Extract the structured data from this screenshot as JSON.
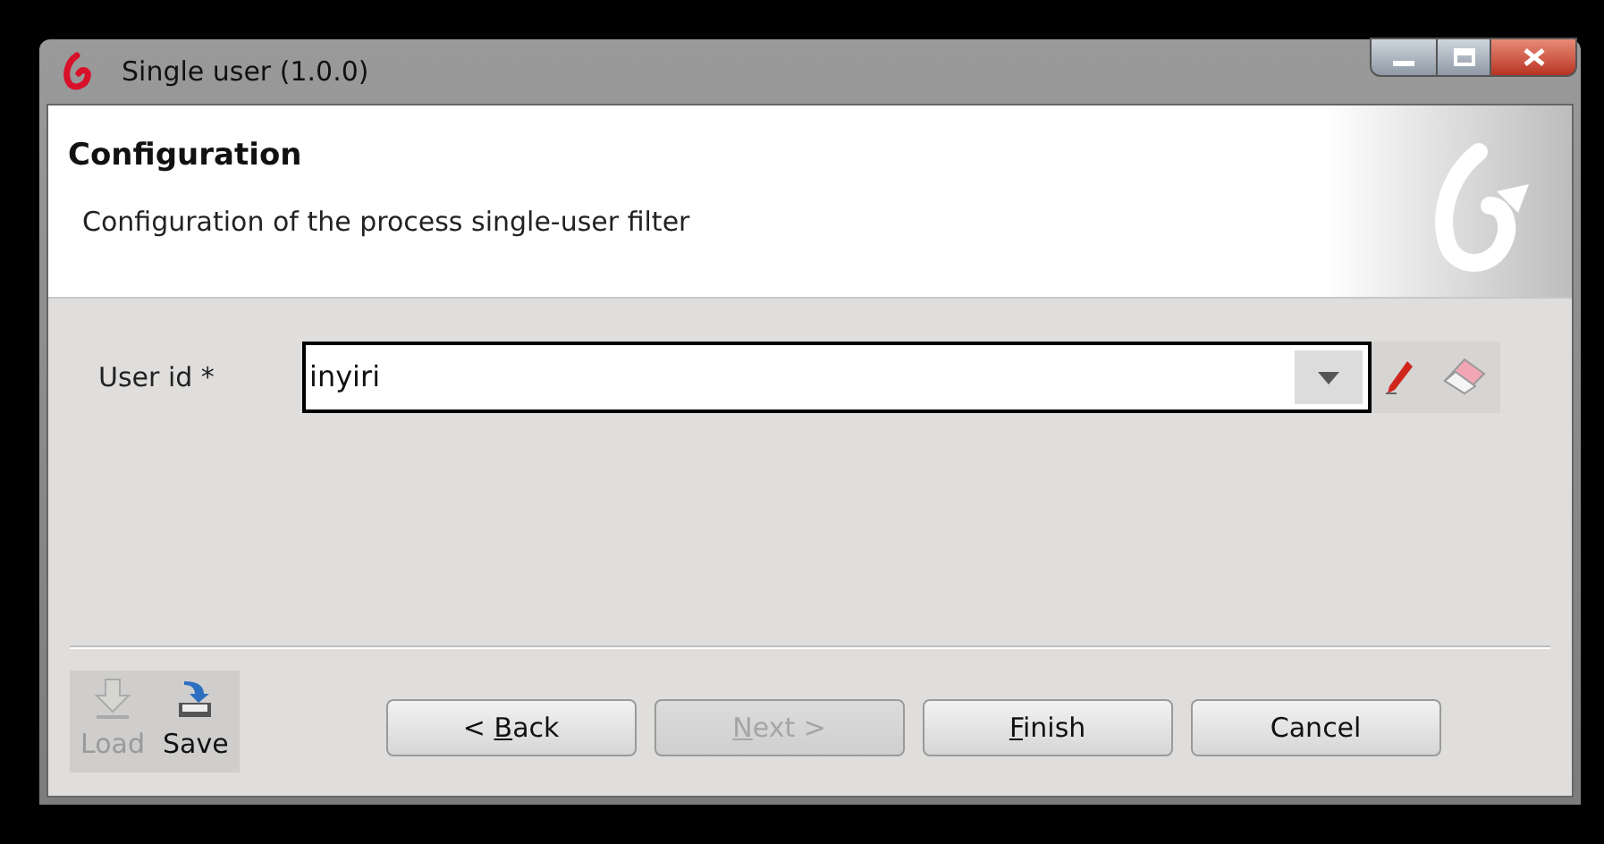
{
  "window": {
    "title": "Single user (1.0.0)"
  },
  "header": {
    "title": "Configuration",
    "description": "Configuration of the process single-user filter"
  },
  "fields": [
    {
      "label": "User id *",
      "value": "inyiri"
    }
  ],
  "store": [
    {
      "label": "Load",
      "disabled": true
    },
    {
      "label": "Save",
      "disabled": false
    }
  ],
  "buttons": [
    {
      "before": "< ",
      "key": "B",
      "after": "ack",
      "disabled": false
    },
    {
      "key": "N",
      "after": "ext >",
      "disabled": true
    },
    {
      "key": "F",
      "after": "inish",
      "disabled": false
    },
    {
      "before": "Cancel",
      "disabled": false
    }
  ]
}
